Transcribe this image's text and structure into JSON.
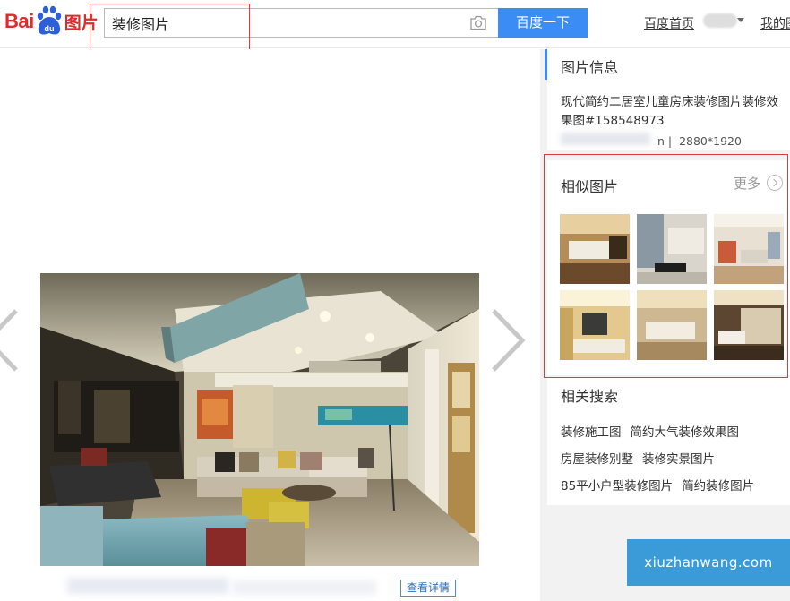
{
  "header": {
    "logo_text_latin": "Bai",
    "logo_paw_text": "du",
    "logo_text_cn": "图片",
    "search_value": "装修图片",
    "search_button": "百度一下",
    "nav_home": "百度首页",
    "nav_mine": "我的图"
  },
  "viewer": {
    "view_detail": "查看详情"
  },
  "sidebar": {
    "info_title": "图片信息",
    "image_description": "现代简约二居室儿童房床装修图片装修效果图#158548973",
    "image_dimensions": "2880*1920",
    "meta_separator": "n  |",
    "similar_title": "相似图片",
    "similar_more": "更多",
    "related_title": "相关搜索",
    "related_rows": [
      [
        "装修施工图",
        "简约大气装修效果图"
      ],
      [
        "房屋装修别墅",
        "装修实景图片"
      ],
      [
        "85平小户型装修图片",
        "简约装修图片"
      ]
    ]
  },
  "watermark": "xiuzhanwang.com",
  "colors": {
    "brand_red": "#de2b2b",
    "search_blue": "#3b8cf4",
    "highlight_red": "#e03b3b"
  },
  "icons": [
    "camera-icon",
    "arrow-left-icon",
    "arrow-right-icon",
    "chevron-right-icon",
    "baidu-paw-logo"
  ]
}
